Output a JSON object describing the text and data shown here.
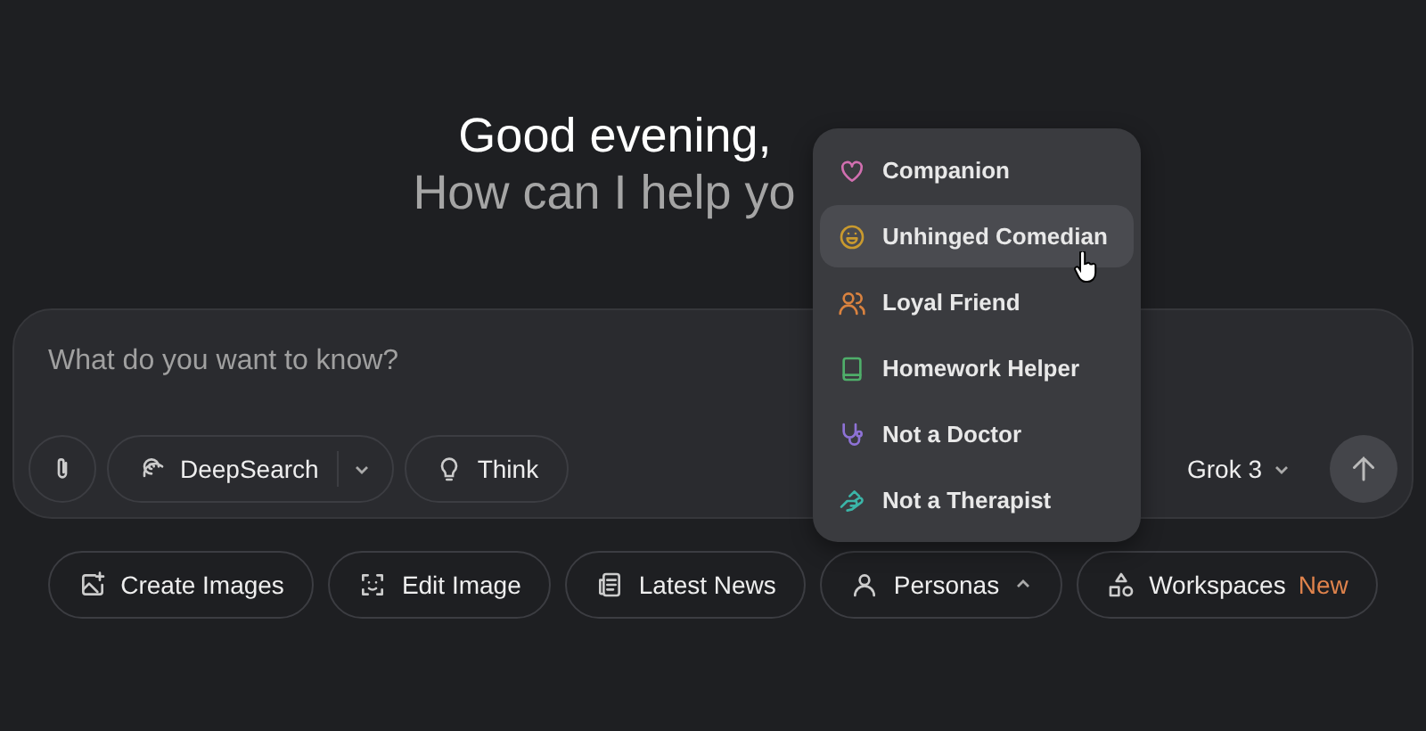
{
  "greeting": "Good evening,",
  "subtitle": "How can I help yo",
  "composer": {
    "placeholder": "What do you want to know?",
    "tools": [
      {
        "kind": "attach"
      },
      {
        "kind": "deepsearch",
        "label": "DeepSearch"
      },
      {
        "kind": "think",
        "label": "Think"
      }
    ],
    "model": "Grok 3"
  },
  "chips": [
    {
      "kind": "image",
      "label": "Create Images"
    },
    {
      "kind": "edit",
      "label": "Edit Image"
    },
    {
      "kind": "news",
      "label": "Latest News"
    },
    {
      "kind": "person",
      "label": "Personas",
      "expanded": true
    },
    {
      "kind": "shapes",
      "label": "Workspaces",
      "badge": "New"
    }
  ],
  "persona_menu": [
    {
      "kind": "heart",
      "label": "Companion",
      "color": "#d16fb0",
      "selected": false
    },
    {
      "kind": "smile",
      "label": "Unhinged Comedian",
      "color": "#c99a2e",
      "selected": true
    },
    {
      "kind": "people",
      "label": "Loyal Friend",
      "color": "#d9823f",
      "selected": false
    },
    {
      "kind": "book",
      "label": "Homework Helper",
      "color": "#4fae6a",
      "selected": false
    },
    {
      "kind": "stetho",
      "label": "Not a Doctor",
      "color": "#8e72d6",
      "selected": false
    },
    {
      "kind": "hand",
      "label": "Not a Therapist",
      "color": "#3bb5a8",
      "selected": false
    }
  ]
}
